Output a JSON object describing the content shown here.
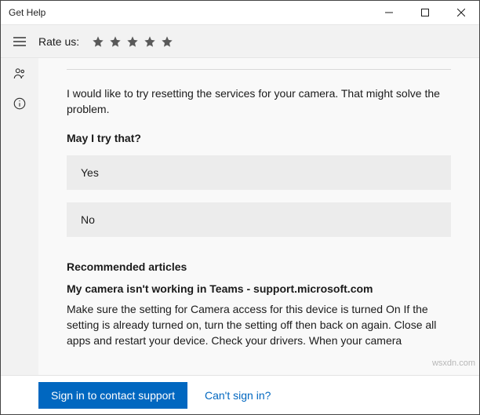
{
  "window": {
    "title": "Get Help"
  },
  "ratebar": {
    "label": "Rate us:"
  },
  "chat": {
    "message": "I would like to try resetting the services for your camera. That might solve the problem.",
    "prompt": "May I try that?",
    "options": {
      "yes": "Yes",
      "no": "No"
    }
  },
  "recommended": {
    "heading": "Recommended articles",
    "article": {
      "title": "My camera isn't working in Teams - support.microsoft.com",
      "body": "Make sure the setting for Camera access for this device is turned On If the setting is already turned on, turn the setting off then back on again. Close all apps and restart your device. Check your drivers. When your camera"
    }
  },
  "footer": {
    "signin": "Sign in to contact support",
    "cantsignin": "Can't sign in?"
  },
  "watermark": "wsxdn.com"
}
